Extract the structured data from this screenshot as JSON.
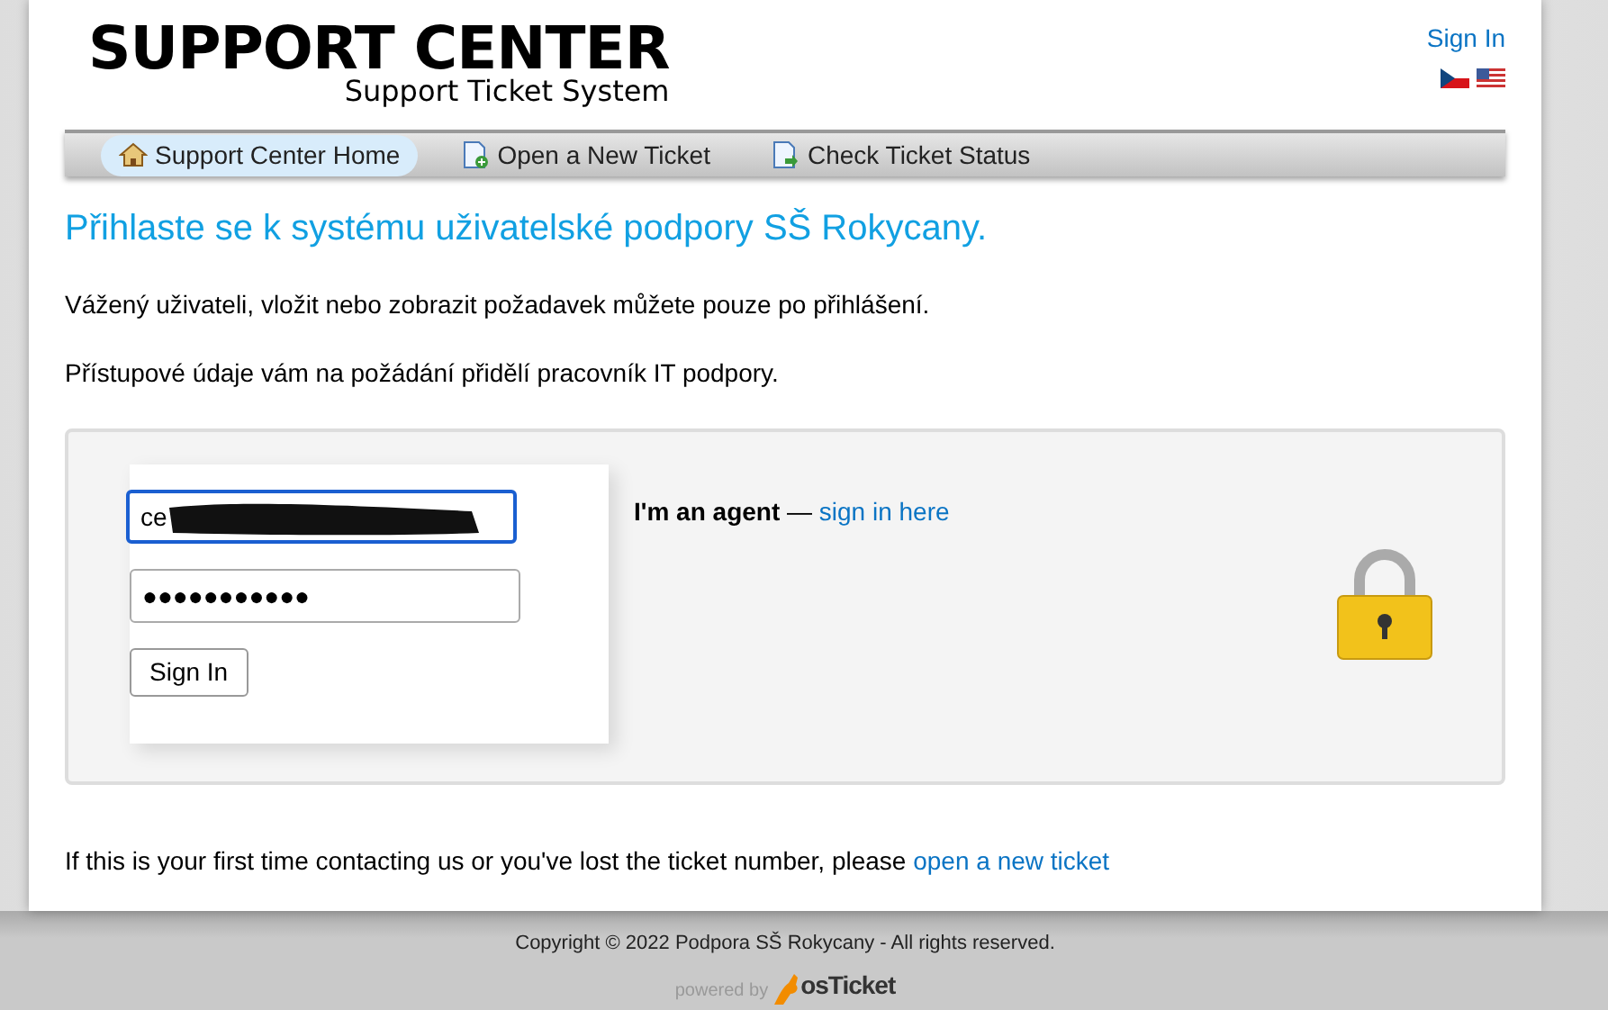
{
  "header": {
    "logo_title": "SUPPORT CENTER",
    "logo_subtitle": "Support Ticket System",
    "sign_in_link": "Sign In",
    "languages": [
      {
        "kind": "czech",
        "selected": false
      },
      {
        "kind": "us",
        "selected": false
      }
    ]
  },
  "nav": [
    {
      "label": "Support Center Home",
      "kind": "home",
      "selected": true
    },
    {
      "label": "Open a New Ticket",
      "kind": "new",
      "selected": false
    },
    {
      "label": "Check Ticket Status",
      "kind": "status",
      "selected": false
    }
  ],
  "heading": "Přihlaste se k systému uživatelské podpory SŠ Rokycany.",
  "paragraphs": [
    "Vážený uživateli, vložit nebo zobrazit požadavek můžete pouze po přihlášení.",
    "Přístupové údaje vám na požádání přidělí pracovník IT podpory."
  ],
  "login": {
    "username": {
      "value": "ce",
      "focused": true,
      "redacted": true
    },
    "password": {
      "value": "●●●●●●●●●●●"
    },
    "button": "Sign In",
    "agent_label": "I'm an agent",
    "agent_dash": "—",
    "agent_link": "sign in here"
  },
  "footer_note": {
    "text": "If this is your first time contacting us or you've lost the ticket number, please",
    "link": "open a new ticket"
  },
  "footer": {
    "copyright": "Copyright © 2022 Podpora SŠ Rokycany - All rights reserved.",
    "powered_by": "powered by",
    "brand": "osTicket"
  }
}
